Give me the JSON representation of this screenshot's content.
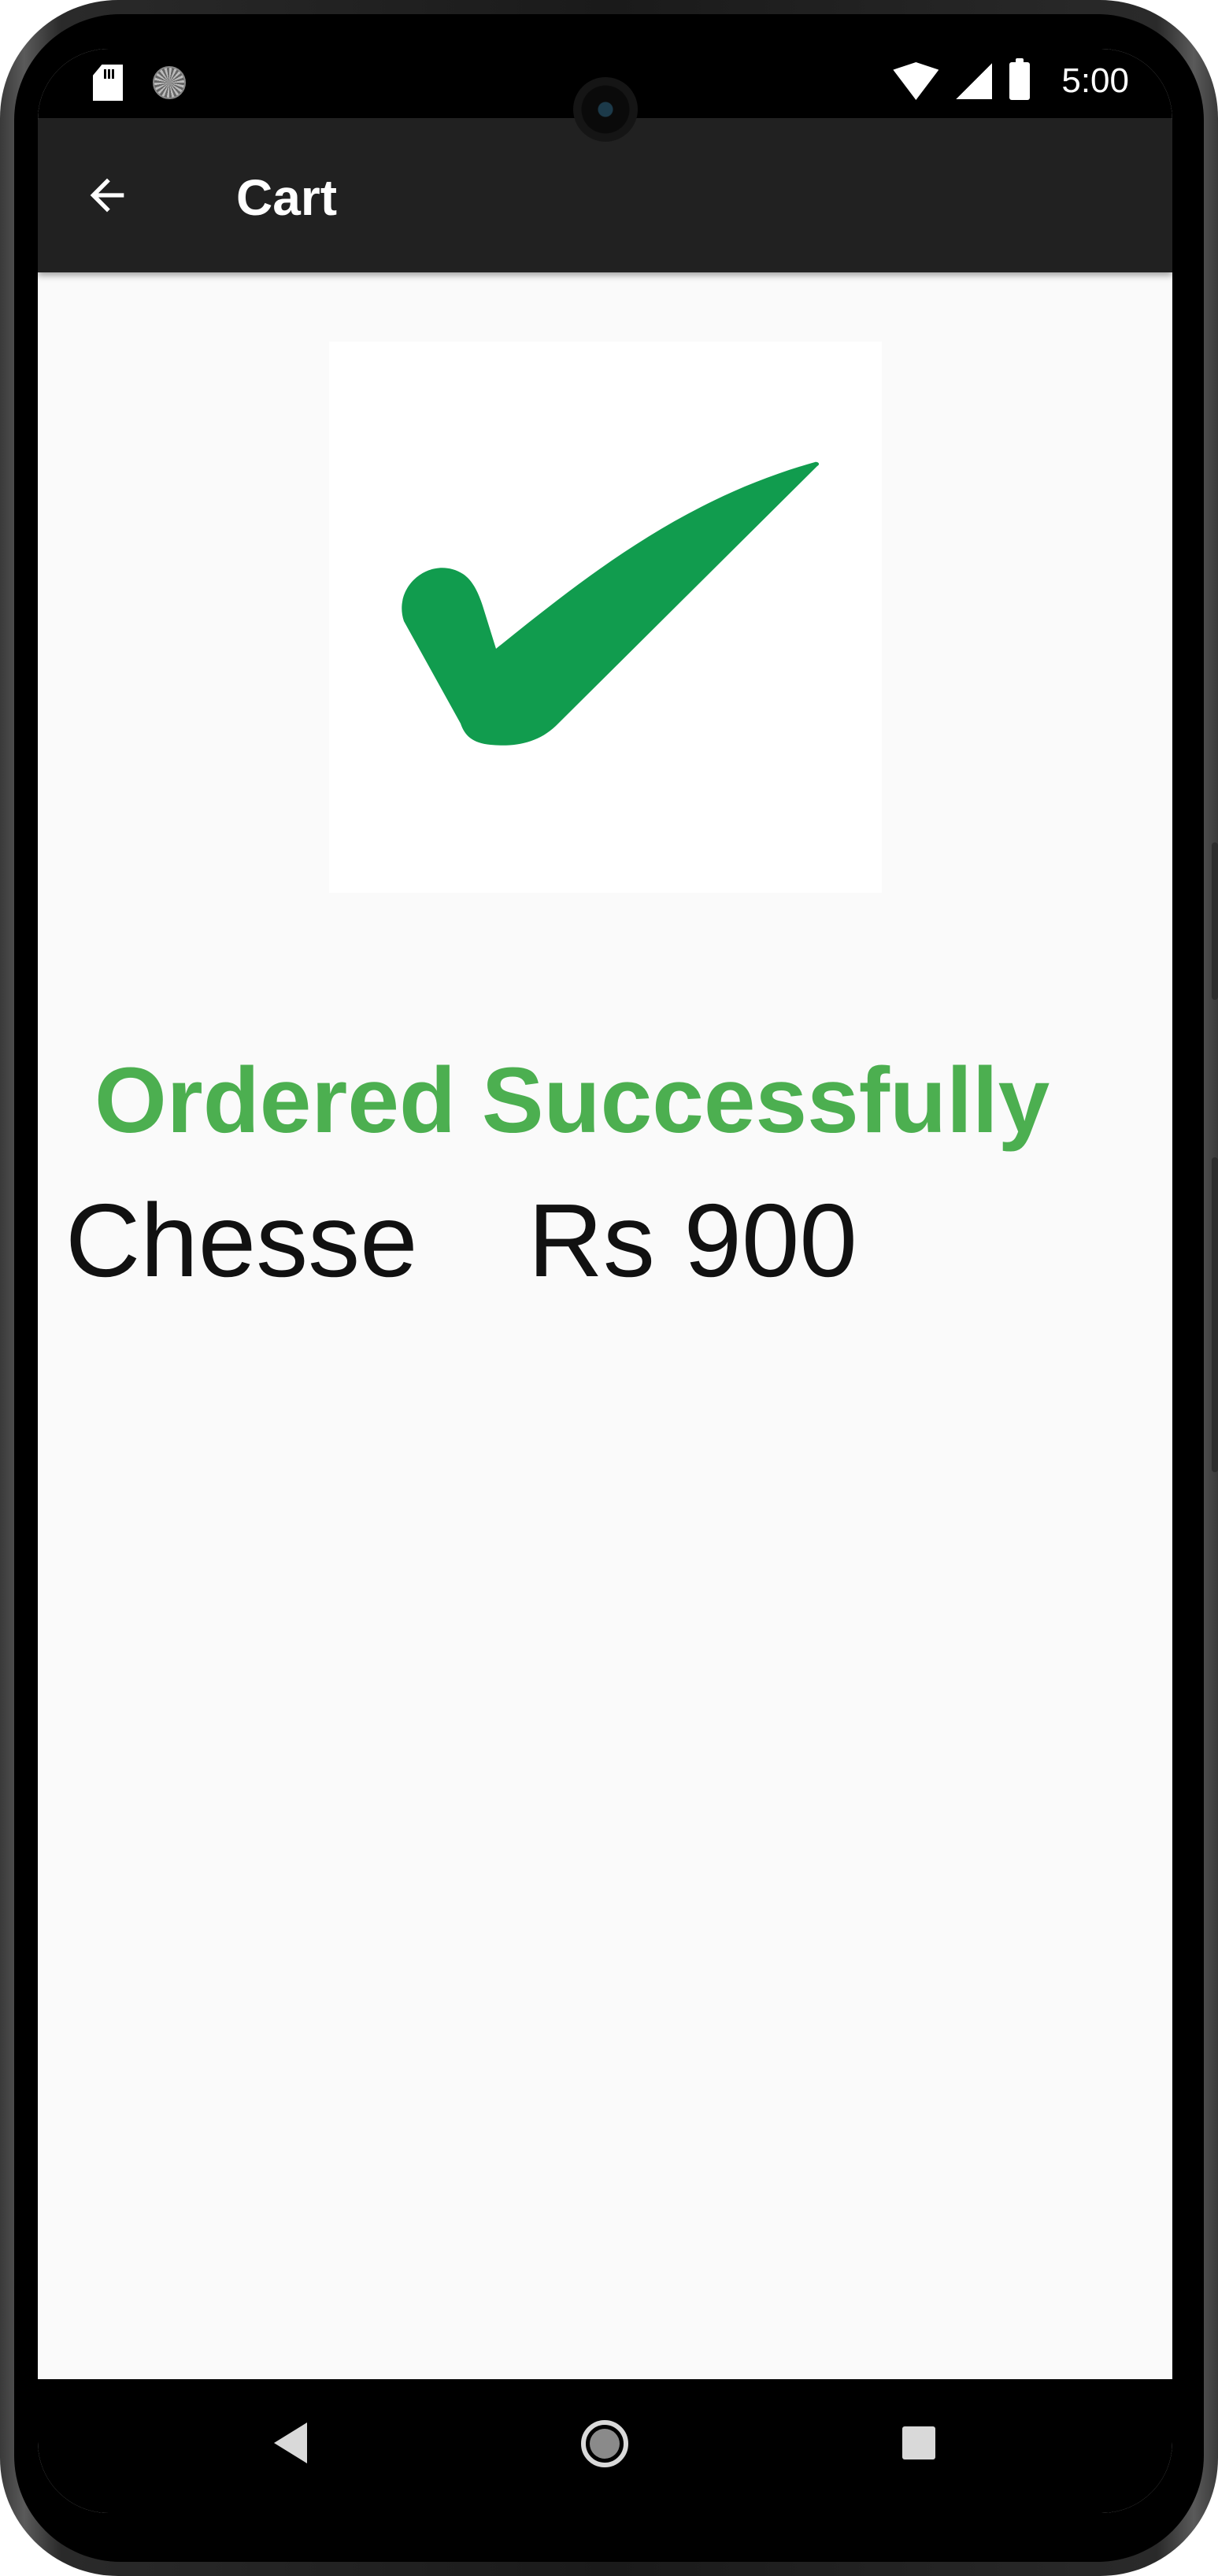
{
  "status_bar": {
    "time": "5:00",
    "icons": [
      "sd-card-icon",
      "loading-icon",
      "wifi-icon",
      "signal-icon",
      "battery-icon"
    ]
  },
  "app_bar": {
    "title": "Cart",
    "back_icon": "arrow-left-icon"
  },
  "content": {
    "success_icon": "checkmark-icon",
    "success_color": "#119c4e",
    "success_message": "Ordered Successfully",
    "success_message_color": "#4caf50",
    "item": {
      "name": "Chesse",
      "price": "Rs 900"
    }
  },
  "nav_bar": {
    "icons": [
      "nav-back-icon",
      "nav-home-icon",
      "nav-recents-icon"
    ]
  },
  "colors": {
    "app_bar": "#212121",
    "background": "#fafafa"
  }
}
